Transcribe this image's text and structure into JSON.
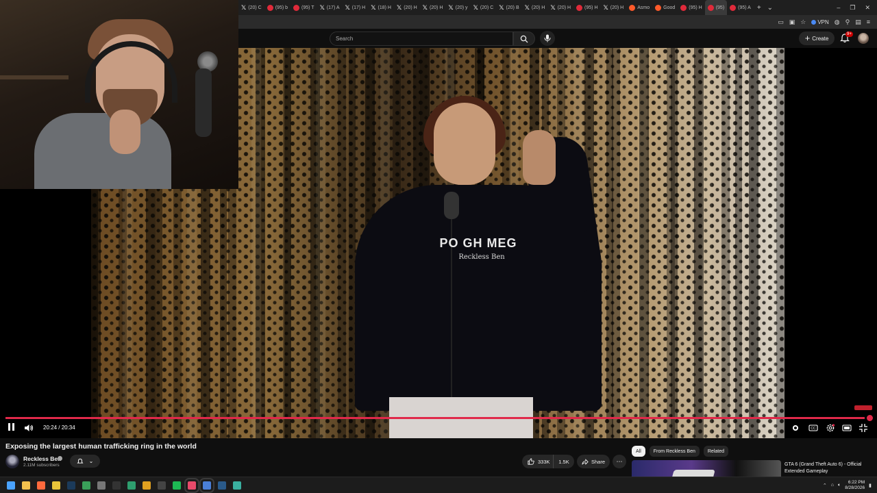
{
  "browser": {
    "tabs": [
      {
        "title": "(20) C",
        "icon": "x-logo-icon",
        "color": "#dddddd"
      },
      {
        "title": "(95) b",
        "icon": "youtube-icon",
        "color": "#e02a3a"
      },
      {
        "title": "(95) T",
        "icon": "youtube-icon",
        "color": "#e02a3a"
      },
      {
        "title": "(17) A",
        "icon": "x-logo-icon",
        "color": "#dddddd"
      },
      {
        "title": "(17) H",
        "icon": "x-logo-icon",
        "color": "#dddddd"
      },
      {
        "title": "(18) H",
        "icon": "x-logo-icon",
        "color": "#dddddd"
      },
      {
        "title": "(20) H",
        "icon": "x-logo-icon",
        "color": "#dddddd"
      },
      {
        "title": "(20) H",
        "icon": "x-logo-icon",
        "color": "#dddddd"
      },
      {
        "title": "(20) y",
        "icon": "x-logo-icon",
        "color": "#dddddd"
      },
      {
        "title": "(20) C",
        "icon": "x-logo-icon",
        "color": "#dddddd"
      },
      {
        "title": "(20) B",
        "icon": "x-logo-icon",
        "color": "#dddddd"
      },
      {
        "title": "(20) H",
        "icon": "x-logo-icon",
        "color": "#dddddd"
      },
      {
        "title": "(20) H",
        "icon": "x-logo-icon",
        "color": "#dddddd"
      },
      {
        "title": "(95) H",
        "icon": "youtube-icon",
        "color": "#e02a3a"
      },
      {
        "title": "(20) H",
        "icon": "x-logo-icon",
        "color": "#dddddd"
      },
      {
        "title": "Asmo",
        "icon": "reddit-icon",
        "color": "#ff5a2a"
      },
      {
        "title": "Good",
        "icon": "reddit-icon",
        "color": "#ff5a2a"
      },
      {
        "title": "(95) H",
        "icon": "youtube-icon",
        "color": "#e02a3a"
      },
      {
        "title": "(95)",
        "icon": "youtube-icon",
        "color": "#e02a3a",
        "active": true
      },
      {
        "title": "(95) A",
        "icon": "youtube-icon",
        "color": "#e02a3a"
      }
    ],
    "new_tab_symbol": "+",
    "tab_list_symbol": "⌄",
    "window_controls": [
      "–",
      "❐",
      "✕"
    ],
    "vpn_label": "VPN"
  },
  "youtube_header": {
    "search_placeholder": "Search",
    "create_label": "Create",
    "notification_count": "9+"
  },
  "player": {
    "current_time": "20:24",
    "duration": "20:34",
    "time_display": "20:24 / 20:34",
    "progress": 0.9919,
    "state": "playing",
    "shirt_text_main": "PO   GH MEG",
    "shirt_text_sub": "Reckless Ben"
  },
  "video": {
    "title": "Exposing the largest human trafficking ring in the world",
    "channel_name": "Reckless Ben",
    "subscriber_count": "2.11M subscribers",
    "likes": "333K",
    "dislikes": "1.5K",
    "share_label": "Share",
    "more_symbol": "⋯"
  },
  "sidebar": {
    "chips": [
      {
        "label": "All",
        "active": true
      },
      {
        "label": "From Reckless Ben",
        "active": false
      },
      {
        "label": "Related",
        "active": false
      }
    ],
    "recommendation": {
      "title": "GTA 6 (Grand Theft Auto 6) - Official Extended Gameplay"
    }
  },
  "taskbar": {
    "apps": [
      {
        "name": "windows-start-icon",
        "color": "#4aa3ff"
      },
      {
        "name": "file-explorer-icon",
        "color": "#f2c14e"
      },
      {
        "name": "browser-icon",
        "color": "#ff6a3d"
      },
      {
        "name": "chrome-icon",
        "color": "#e9c53a"
      },
      {
        "name": "steam-icon",
        "color": "#1b3a5a"
      },
      {
        "name": "app-icon",
        "color": "#3aa05a"
      },
      {
        "name": "tool-icon",
        "color": "#777777"
      },
      {
        "name": "obs-icon",
        "color": "#333333"
      },
      {
        "name": "app-green-icon",
        "color": "#2e9e6e"
      },
      {
        "name": "folder-icon",
        "color": "#e0a020"
      },
      {
        "name": "media-icon",
        "color": "#444444"
      },
      {
        "name": "spotify-icon",
        "color": "#1db954"
      },
      {
        "name": "browser-active-icon",
        "color": "#e84a6a",
        "active": true
      },
      {
        "name": "notepad-icon",
        "color": "#4a7fd8",
        "active": true
      },
      {
        "name": "steam-alt-icon",
        "color": "#2a5a8a"
      },
      {
        "name": "globe-icon",
        "color": "#3ab0a0"
      }
    ],
    "time": "6:22 PM",
    "date": "8/28/2026"
  },
  "colors": {
    "progress": "#e0294a",
    "youtube_bg": "#0f0f0f",
    "chip_active_bg": "#f1f1f1"
  }
}
